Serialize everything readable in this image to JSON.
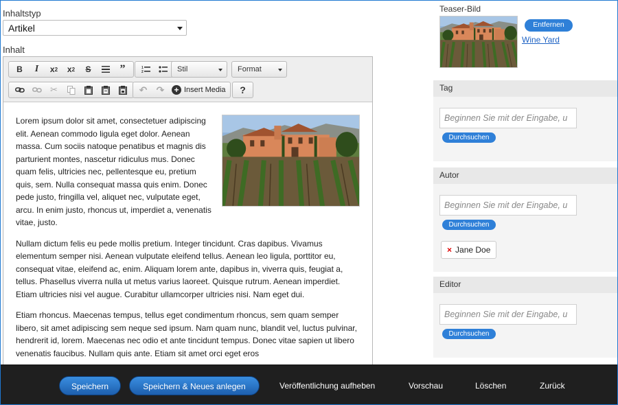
{
  "content_type": {
    "label": "Inhaltstyp",
    "value": "Artikel"
  },
  "content": {
    "label": "Inhalt",
    "toolbar": {
      "style_dropdown": "Stil",
      "format_dropdown": "Format",
      "insert_media": "Insert Media",
      "help": "?"
    },
    "paragraphs": [
      "Lorem ipsum dolor sit amet, consectetuer adipiscing elit. Aenean commodo ligula eget dolor. Aenean massa. Cum sociis natoque penatibus et magnis dis parturient montes, nascetur ridiculus mus. Donec quam felis, ultricies nec, pellentesque eu, pretium quis, sem. Nulla consequat massa quis enim. Donec pede justo, fringilla vel, aliquet nec, vulputate eget, arcu. In enim justo, rhoncus ut, imperdiet a, venenatis vitae, justo.",
      "Nullam dictum felis eu pede mollis pretium. Integer tincidunt. Cras dapibus. Vivamus elementum semper nisi. Aenean vulputate eleifend tellus. Aenean leo ligula, porttitor eu, consequat vitae, eleifend ac, enim. Aliquam lorem ante, dapibus in, viverra quis, feugiat a, tellus. Phasellus viverra nulla ut metus varius laoreet. Quisque rutrum. Aenean imperdiet. Etiam ultricies nisi vel augue. Curabitur ullamcorper ultricies nisi. Nam eget dui.",
      "Etiam rhoncus. Maecenas tempus, tellus eget condimentum rhoncus, sem quam semper libero, sit amet adipiscing sem neque sed ipsum. Nam quam nunc, blandit vel, luctus pulvinar, hendrerit id, lorem. Maecenas nec odio et ante tincidunt tempus. Donec vitae sapien ut libero venenatis faucibus. Nullam quis ante. Etiam sit amet orci eget eros"
    ]
  },
  "teaser": {
    "label": "Teaser-Bild",
    "remove_label": "Entfernen",
    "image_name": "Wine Yard"
  },
  "panels": {
    "tag": {
      "title": "Tag",
      "placeholder": "Beginnen Sie mit der Eingabe, u",
      "search_label": "Durchsuchen"
    },
    "author": {
      "title": "Autor",
      "placeholder": "Beginnen Sie mit der Eingabe, u",
      "search_label": "Durchsuchen",
      "chip": "Jane Doe"
    },
    "editor": {
      "title": "Editor",
      "placeholder": "Beginnen Sie mit der Eingabe, u",
      "search_label": "Durchsuchen"
    }
  },
  "footer": {
    "save": "Speichern",
    "save_new": "Speichern & Neues anlegen",
    "unpublish": "Veröffentlichung aufheben",
    "preview": "Vorschau",
    "delete": "Löschen",
    "back": "Zurück"
  },
  "colors": {
    "accent": "#2f80d8",
    "footer_bg": "#1f1f1f",
    "link": "#1d62c4",
    "remove_x": "#dd0000"
  }
}
